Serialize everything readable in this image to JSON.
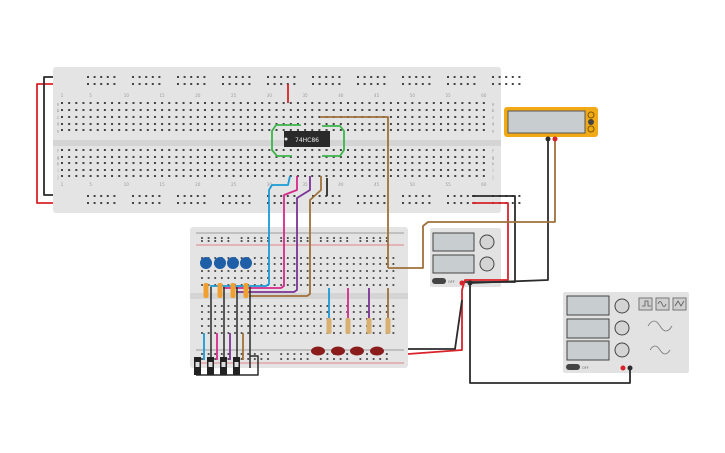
{
  "chip": {
    "label": "74HC86"
  },
  "breadboard_top": {
    "column_numbers": [
      "1",
      "5",
      "10",
      "15",
      "20",
      "25",
      "30",
      "35",
      "40",
      "45",
      "50",
      "55",
      "60"
    ],
    "row_letters_top": [
      "a",
      "b",
      "c",
      "d",
      "e"
    ],
    "row_letters_bottom": [
      "f",
      "g",
      "h",
      "i",
      "j"
    ]
  },
  "power_supply": {
    "switch_label": "OFF"
  },
  "function_generator": {
    "switch_label": "OFF"
  },
  "colors": {
    "wire_red": "#d9232a",
    "wire_black": "#2b2b2b",
    "wire_blue": "#1a9ad6",
    "wire_pink": "#d42a8c",
    "wire_purple": "#7b3294",
    "wire_brown": "#a0703a",
    "wire_green": "#3bb54a",
    "multimeter": "#f2a916",
    "led": "#8b1c1c",
    "capacitor": "#1e5fa8"
  }
}
